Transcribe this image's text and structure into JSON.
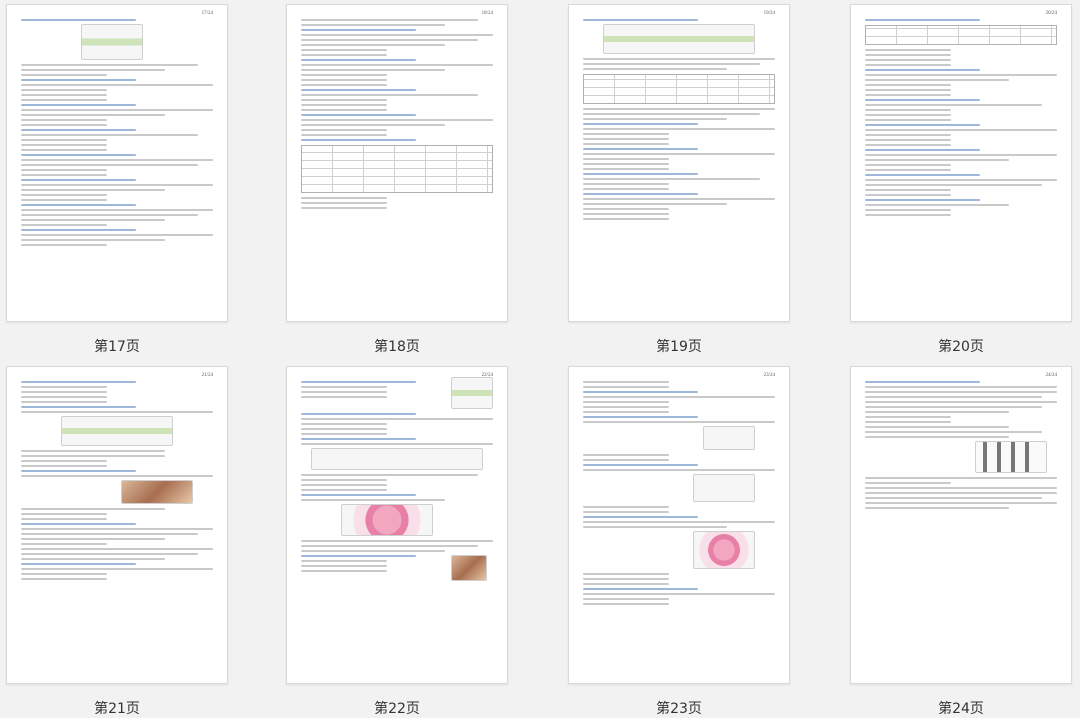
{
  "pages": [
    {
      "num": "17/24",
      "caption": "第17页"
    },
    {
      "num": "18/24",
      "caption": "第18页"
    },
    {
      "num": "19/24",
      "caption": "第19页"
    },
    {
      "num": "20/24",
      "caption": "第20页"
    },
    {
      "num": "21/24",
      "caption": "第21页"
    },
    {
      "num": "22/24",
      "caption": "第22页"
    },
    {
      "num": "23/24",
      "caption": "第23页"
    },
    {
      "num": "24/24",
      "caption": "第24页"
    }
  ]
}
